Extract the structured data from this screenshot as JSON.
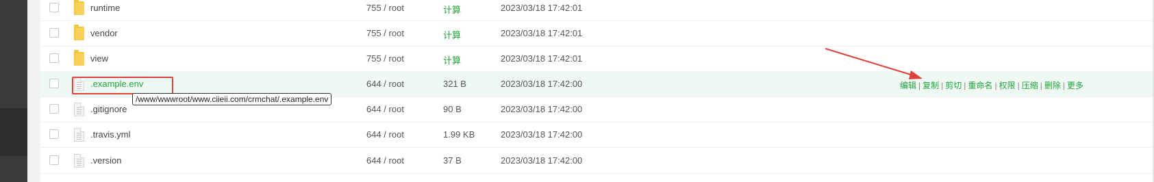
{
  "files": [
    {
      "name": "runtime",
      "type": "folder",
      "permission": "755 / root",
      "size": "计算",
      "mtime": "2023/03/18 17:42:01"
    },
    {
      "name": "vendor",
      "type": "folder",
      "permission": "755 / root",
      "size": "计算",
      "mtime": "2023/03/18 17:42:01"
    },
    {
      "name": "view",
      "type": "folder",
      "permission": "755 / root",
      "size": "计算",
      "mtime": "2023/03/18 17:42:01"
    },
    {
      "name": ".example.env",
      "type": "file",
      "permission": "644 / root",
      "size": "321 B",
      "mtime": "2023/03/18 17:42:00"
    },
    {
      "name": ".gitignore",
      "type": "file",
      "permission": "644 / root",
      "size": "90 B",
      "mtime": "2023/03/18 17:42:00"
    },
    {
      "name": ".travis.yml",
      "type": "file",
      "permission": "644 / root",
      "size": "1.99 KB",
      "mtime": "2023/03/18 17:42:00"
    },
    {
      "name": ".version",
      "type": "file",
      "permission": "644 / root",
      "size": "37 B",
      "mtime": "2023/03/18 17:42:00"
    }
  ],
  "selected_row": {
    "operations": [
      "编辑",
      "复制",
      "剪切",
      "重命名",
      "权限",
      "压缩",
      "删除",
      "更多"
    ],
    "separator": "|"
  },
  "tooltip": "/www/wwwroot/www.ciieii.com/crmchat/.example.env",
  "colors": {
    "accent": "#20a53a",
    "annotation": "#e0403a",
    "highlight_row": "#f0f8f4",
    "sidebar": "#3b3b3b"
  },
  "icons": {
    "folder": "folder-icon",
    "file": "file-icon",
    "checkbox": "checkbox"
  }
}
